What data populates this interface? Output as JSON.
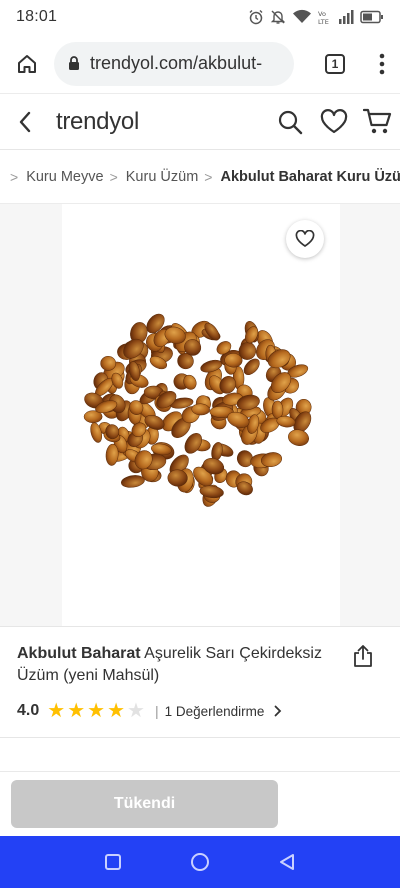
{
  "status_bar": {
    "time": "18:01",
    "icons": [
      "alarm-icon",
      "mute-icon",
      "wifi-icon",
      "volte-icon",
      "signal-icon",
      "battery-icon"
    ]
  },
  "browser": {
    "url": "trendyol.com/akbulut-",
    "tab_count": "1",
    "icons": [
      "home-icon",
      "lock-icon",
      "tabs-icon",
      "more-vert-icon"
    ]
  },
  "header": {
    "logo": "trendyol",
    "icons": [
      "back-arrow-icon",
      "search-icon",
      "heart-icon",
      "cart-icon"
    ]
  },
  "breadcrumb": {
    "items": [
      "Kuru Meyve",
      "Kuru Üzüm"
    ],
    "current": "Akbulut Baharat Kuru Üzü"
  },
  "product": {
    "brand": "Akbulut Baharat",
    "name": " Aşurelik Sarı Çekirdeksiz Üzüm (yeni Mahsül)",
    "rating_value": "4.0",
    "rating_stars": 4,
    "rating_max": 5,
    "review_separator": "|",
    "review_text": "1 Değerlendirme",
    "image": "raisins-pile-image"
  },
  "actions": {
    "soldout_label": "Tükendi"
  },
  "nav": {
    "icons": [
      "recent-apps-icon",
      "home-circle-icon",
      "back-triangle-icon"
    ]
  },
  "colors": {
    "star": "#ffc000",
    "nav_bar": "#2341f5",
    "soldout_button": "#c8c8c8"
  }
}
